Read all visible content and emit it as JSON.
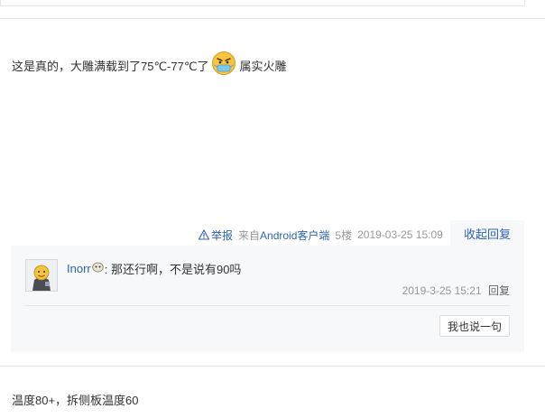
{
  "post1": {
    "text_before": "这是真的，大雕满载到了75℃-77℃了",
    "emoji": "sick-face-emoji",
    "text_after": "属实火雕",
    "tail": {
      "report": "举报",
      "from_prefix": "来自",
      "client": "Android客户端",
      "floor": "5楼",
      "time": "2019-03-25 15:09",
      "collapse": "收起回复"
    }
  },
  "reply": {
    "user": "Inorr",
    "content": ": 那还行啊，不是说有90吗",
    "time": "2019-3-25 15:21",
    "reply_label": "回复"
  },
  "say_button": "我也说一句",
  "post2": {
    "text": "温度80+，拆侧板温度60"
  },
  "colors": {
    "link": "#2d64b3",
    "meta": "#999999",
    "reply_bg": "#f7f8fa"
  }
}
